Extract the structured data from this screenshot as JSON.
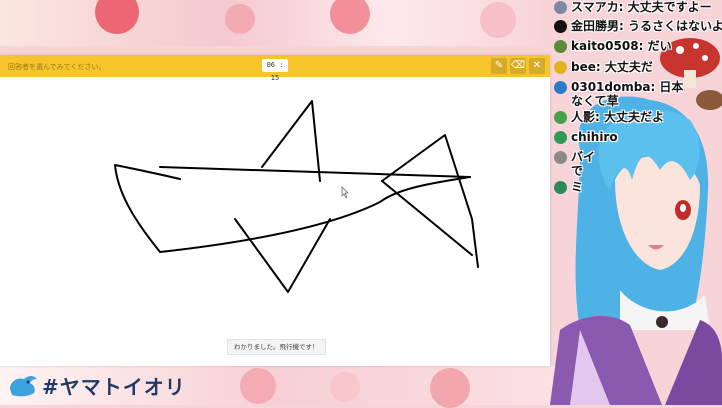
{
  "toolbar": {
    "prompt": "回答者を選んでみてください。",
    "timer": "06 : 15",
    "pen_tool_label": "✎",
    "eraser_tool_label": "⌫",
    "close_tool_label": "✕"
  },
  "answer_bubble": "わかりました。飛行機です！",
  "logo_text": "#ヤマトイオリ",
  "chat": [
    {
      "name": "スマアカ",
      "text": "大丈夫ですよー",
      "avatar_color": "#7b8aa0"
    },
    {
      "name": "金田勝男",
      "text": "うるさくはないよ",
      "avatar_color": "#111111"
    },
    {
      "name": "kaito0508",
      "text": "だい",
      "avatar_color": "#5a8a3a"
    },
    {
      "name": "bee",
      "text": "大丈夫だ",
      "avatar_color": "#e2b21c"
    },
    {
      "name": "0301domba",
      "text": "日本",
      "text2": "なくて草",
      "avatar_color": "#2b7ac9"
    },
    {
      "name": "人影",
      "text": "大丈夫だよ",
      "avatar_color": "#4aa04a"
    },
    {
      "name": "chihiro",
      "text": "",
      "avatar_color": "#2e9a55"
    },
    {
      "name": "バイ",
      "text": "",
      "text2": "で",
      "avatar_color": "#8a8a8a"
    },
    {
      "name": "ミ",
      "text": "",
      "avatar_color": "#2e8a55"
    }
  ],
  "colors": {
    "toolbar": "#f6c52b",
    "logo": "#1f3a66",
    "hair": "#4fb2e6"
  }
}
